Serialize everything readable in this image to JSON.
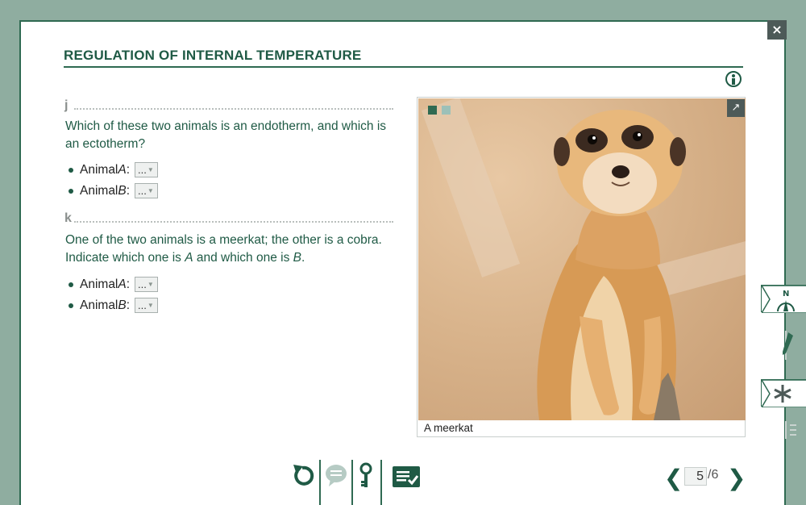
{
  "header": {
    "title": "REGULATION OF INTERNAL TEMPERATURE",
    "close_label": "×"
  },
  "questions": [
    {
      "letter": "j",
      "text": "Which of these two animals is an endotherm, and which is an ectotherm?",
      "items": [
        {
          "prefix": "Animal ",
          "animal": "A",
          "suffix": ":",
          "value": "..."
        },
        {
          "prefix": "Animal ",
          "animal": "B",
          "suffix": ":",
          "value": "..."
        }
      ]
    },
    {
      "letter": "k",
      "text_parts": [
        "One of the two animals is a meerkat; the other is a cobra. Indicate which one is ",
        "A",
        " and which one is ",
        "B",
        "."
      ],
      "items": [
        {
          "prefix": "Animal ",
          "animal": "A",
          "suffix": ":",
          "value": "..."
        },
        {
          "prefix": "Animal ",
          "animal": "B",
          "suffix": ":",
          "value": "..."
        }
      ]
    }
  ],
  "figure": {
    "caption": "A meerkat",
    "expand_glyph": "↗"
  },
  "side_tabs": {
    "compass_label": "N"
  },
  "pagination": {
    "current": "5",
    "total": "/6",
    "prev": "❮",
    "next": "❯"
  },
  "colors": {
    "brand_green": "#1f5a45",
    "frame_green": "#2f6a52",
    "background": "#8fada0"
  },
  "icons": [
    "close-icon",
    "info-icon",
    "expand-icon",
    "compass-icon",
    "pencil-icon",
    "asterisk-icon",
    "list-icon",
    "reset-icon",
    "comment-icon",
    "key-icon",
    "checklist-icon",
    "chevron-left-icon",
    "chevron-right-icon"
  ]
}
